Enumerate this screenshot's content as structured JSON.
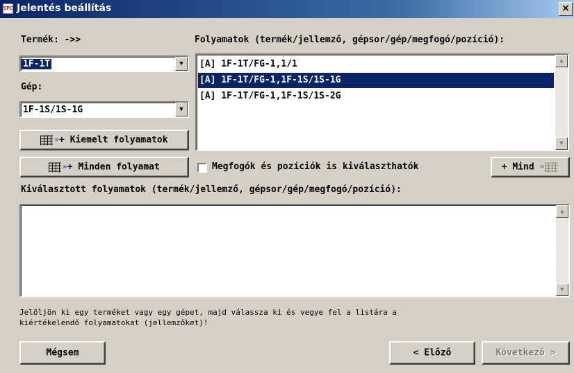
{
  "window": {
    "app_icon": "SPC",
    "title": "Jelentés beállítás",
    "close_icon": "×"
  },
  "product": {
    "label": "Termék: ->>",
    "value": "1F-1T"
  },
  "machine": {
    "label": "Gép:",
    "value": "1F-1S/1S-1G"
  },
  "processes": {
    "label": "Folyamatok (termék/jellemző, gépsor/gép/megfogó/pozíció):",
    "items": [
      "[A] 1F-1T/FG-1,1/1",
      "[A] 1F-1T/FG-1,1F-1S/1S-1G",
      "[A] 1F-1T/FG-1,1F-1S/1S-2G"
    ],
    "selected_index": 1
  },
  "buttons": {
    "highlighted": "Kiemelt folyamatok",
    "all": "Minden folyamat",
    "add_all": "Mind",
    "cancel": "Mégsem",
    "previous": "Előző",
    "next": "Következő"
  },
  "icons": {
    "grid": "grid-icon",
    "chevron_down": "»",
    "plus": "+",
    "arrow_left": "<",
    "arrow_right": ">",
    "scroll_up": "▲",
    "scroll_down": "▼"
  },
  "checkbox": {
    "label": "Megfogók és pozíciók is kiválaszthatók",
    "checked": false
  },
  "selected_processes": {
    "label": "Kiválasztott folyamatok (termék/jellemző, gépsor/gép/megfogó/pozíció):",
    "items": []
  },
  "hint": {
    "line1": "Jelöljön ki egy terméket vagy egy gépet, majd válassza ki és vegye fel a listára a",
    "line2": "kiértékelendő folyamatokat (jellemzőket)!"
  },
  "colors": {
    "face": "#d4d0c8",
    "selection": "#0a246a",
    "title_start": "#0a246a",
    "title_end": "#a6caf0"
  }
}
